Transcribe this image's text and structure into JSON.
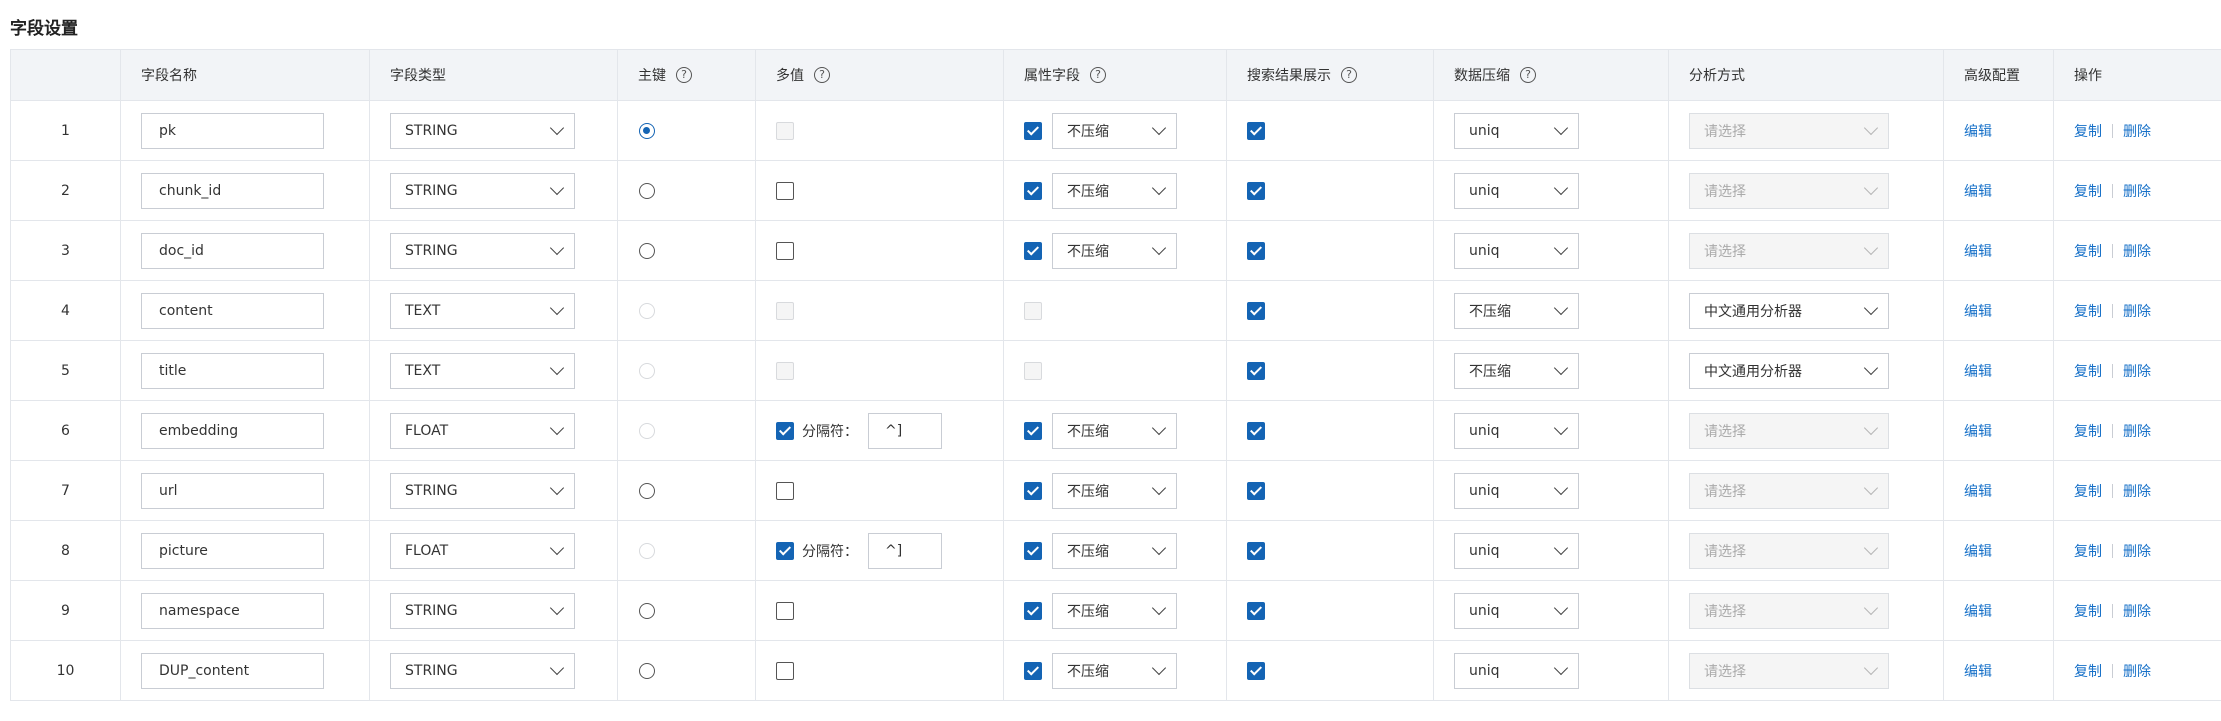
{
  "page_title": "字段设置",
  "headers": {
    "name": "字段名称",
    "type": "字段类型",
    "primary": "主键",
    "multi": "多值",
    "attr": "属性字段",
    "display": "搜索结果展示",
    "compress": "数据压缩",
    "analyzer": "分析方式",
    "advanced": "高级配置",
    "actions": "操作"
  },
  "help_glyph": "?",
  "labels": {
    "separator": "分隔符：",
    "edit": "编辑",
    "copy": "复制",
    "delete": "删除",
    "placeholder": "请选择"
  },
  "rows": [
    {
      "index": "1",
      "name": "pk",
      "type": "STRING",
      "primary": "selected",
      "multi": "disabled",
      "separator": "",
      "attr": true,
      "attr_compress": "不压缩",
      "display": true,
      "compress": "uniq",
      "analyzer": ""
    },
    {
      "index": "2",
      "name": "chunk_id",
      "type": "STRING",
      "primary": "enabled",
      "multi": "unchecked",
      "separator": "",
      "attr": true,
      "attr_compress": "不压缩",
      "display": true,
      "compress": "uniq",
      "analyzer": ""
    },
    {
      "index": "3",
      "name": "doc_id",
      "type": "STRING",
      "primary": "enabled",
      "multi": "unchecked",
      "separator": "",
      "attr": true,
      "attr_compress": "不压缩",
      "display": true,
      "compress": "uniq",
      "analyzer": ""
    },
    {
      "index": "4",
      "name": "content",
      "type": "TEXT",
      "primary": "disabled",
      "multi": "disabled",
      "separator": "",
      "attr": false,
      "attr_compress": "",
      "display": true,
      "compress": "不压缩",
      "analyzer": "中文通用分析器"
    },
    {
      "index": "5",
      "name": "title",
      "type": "TEXT",
      "primary": "disabled",
      "multi": "disabled",
      "separator": "",
      "attr": false,
      "attr_compress": "",
      "display": true,
      "compress": "不压缩",
      "analyzer": "中文通用分析器"
    },
    {
      "index": "6",
      "name": "embedding",
      "type": "FLOAT",
      "primary": "disabled",
      "multi": "checked",
      "separator": "^]",
      "attr": true,
      "attr_compress": "不压缩",
      "display": true,
      "compress": "uniq",
      "analyzer": ""
    },
    {
      "index": "7",
      "name": "url",
      "type": "STRING",
      "primary": "enabled",
      "multi": "unchecked",
      "separator": "",
      "attr": true,
      "attr_compress": "不压缩",
      "display": true,
      "compress": "uniq",
      "analyzer": ""
    },
    {
      "index": "8",
      "name": "picture",
      "type": "FLOAT",
      "primary": "disabled",
      "multi": "checked",
      "separator": "^]",
      "attr": true,
      "attr_compress": "不压缩",
      "display": true,
      "compress": "uniq",
      "analyzer": ""
    },
    {
      "index": "9",
      "name": "namespace",
      "type": "STRING",
      "primary": "enabled",
      "multi": "unchecked",
      "separator": "",
      "attr": true,
      "attr_compress": "不压缩",
      "display": true,
      "compress": "uniq",
      "analyzer": ""
    },
    {
      "index": "10",
      "name": "DUP_content",
      "type": "STRING",
      "primary": "enabled",
      "multi": "unchecked",
      "separator": "",
      "attr": true,
      "attr_compress": "不压缩",
      "display": true,
      "compress": "uniq",
      "analyzer": ""
    }
  ],
  "colors": {
    "accent": "#1464b4",
    "link": "#1670c8",
    "header_bg": "#f2f4f7",
    "border": "#e3e6eb"
  }
}
